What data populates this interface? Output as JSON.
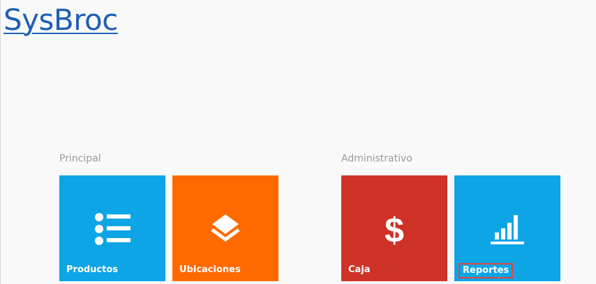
{
  "app": {
    "brand": "SysBroc"
  },
  "groups": [
    {
      "title": "Principal",
      "tiles": [
        {
          "label": "Productos",
          "icon": "list-icon",
          "color": "#0ea5e6"
        },
        {
          "label": "Ubicaciones",
          "icon": "layers-icon",
          "color": "#ff6a00"
        }
      ]
    },
    {
      "title": "Administrativo",
      "tiles": [
        {
          "label": "Caja",
          "icon": "dollar-icon",
          "color": "#cf3328"
        },
        {
          "label": "Reportes",
          "icon": "bar-chart-icon",
          "color": "#0ea5e6",
          "focused": true
        }
      ]
    }
  ]
}
